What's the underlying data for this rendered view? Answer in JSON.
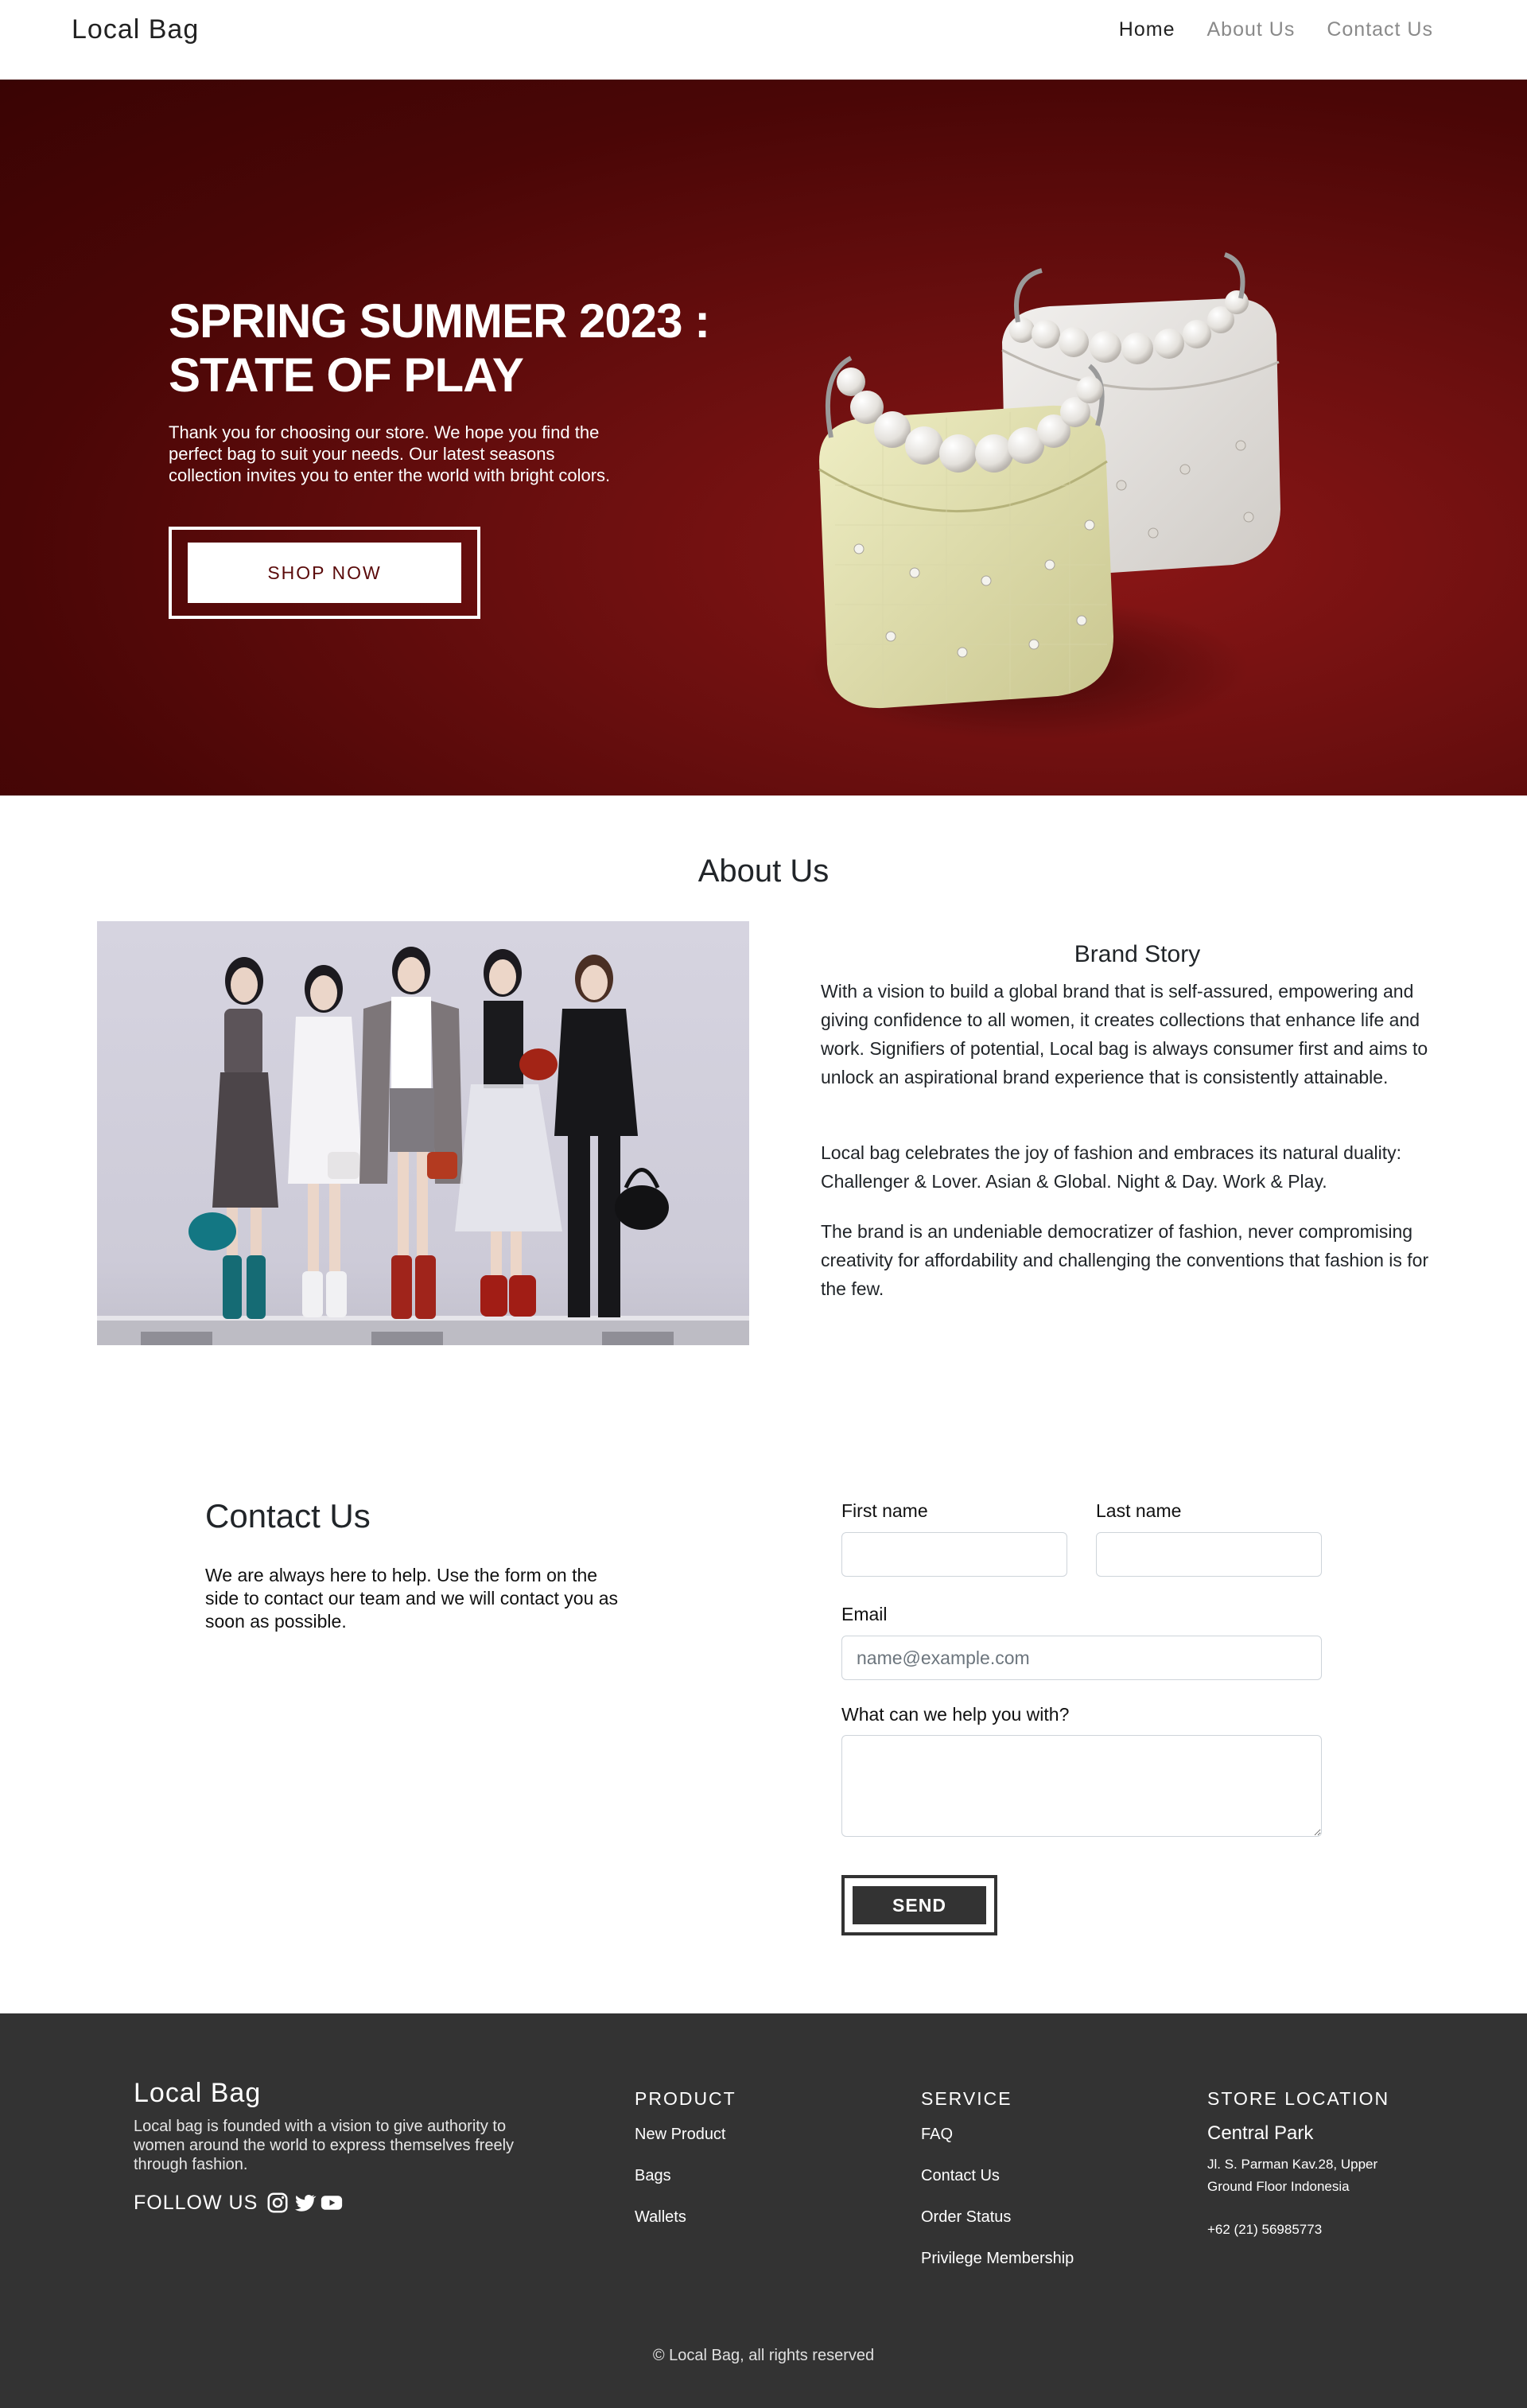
{
  "nav": {
    "brand": "Local Bag",
    "links": [
      "Home",
      "About Us",
      "Contact Us"
    ],
    "active_index": 0
  },
  "hero": {
    "title": "SPRING SUMMER 2023 : STATE OF PLAY",
    "text": "Thank you for choosing our store. We hope you find the perfect bag to suit your needs. Our latest seasons collection invites you to enter the world with bright colors.",
    "button": "SHOP NOW",
    "image": "two-tweed-handbags-with-pearl-handles",
    "bg_color": "#6b0f0f"
  },
  "about": {
    "title": "About Us",
    "image": "five-models-holding-handbags",
    "story_title": "Brand Story",
    "paragraphs": [
      "With a vision to build a global brand that is self-assured, empowering and giving confidence to all women, it creates collections that enhance life and work. Signifiers of potential, Local bag is always consumer first and aims to unlock an aspirational brand experience that is consistently attainable.",
      "Local bag celebrates the joy of fashion and embraces its natural duality: Challenger & Lover. Asian & Global. Night & Day. Work & Play.",
      "The brand is an undeniable democratizer of fashion, never compromising creativity for affordability and challenging the conventions that fashion is for the few."
    ]
  },
  "contact": {
    "title": "Contact Us",
    "text": "We are always here to help. Use the form on the side to contact our team and we will contact you as soon as possible.",
    "first_name_label": "First name",
    "last_name_label": "Last name",
    "email_label": "Email",
    "email_placeholder": "name@example.com",
    "message_label": "What can we help you with?",
    "send": "SEND"
  },
  "footer": {
    "brand": "Local Bag",
    "description": "Local bag is founded with a vision to give authority to women around the world to express themselves freely through fashion.",
    "follow": "FOLLOW US",
    "social_icons": [
      "instagram-icon",
      "twitter-icon",
      "youtube-icon"
    ],
    "product_title": "PRODUCT",
    "product_links": [
      "New Product",
      "Bags",
      "Wallets"
    ],
    "service_title": "SERVICE",
    "service_links": [
      "FAQ",
      "Contact Us",
      "Order Status",
      "Privilege Membership"
    ],
    "location_title": "STORE LOCATION",
    "location_name": "Central Park",
    "address": "Jl. S. Parman Kav.28, Upper Ground Floor Indonesia",
    "phone": "+62 (21) 56985773",
    "copyright": "© Local Bag, all rights reserved",
    "bg_color": "#333333"
  }
}
